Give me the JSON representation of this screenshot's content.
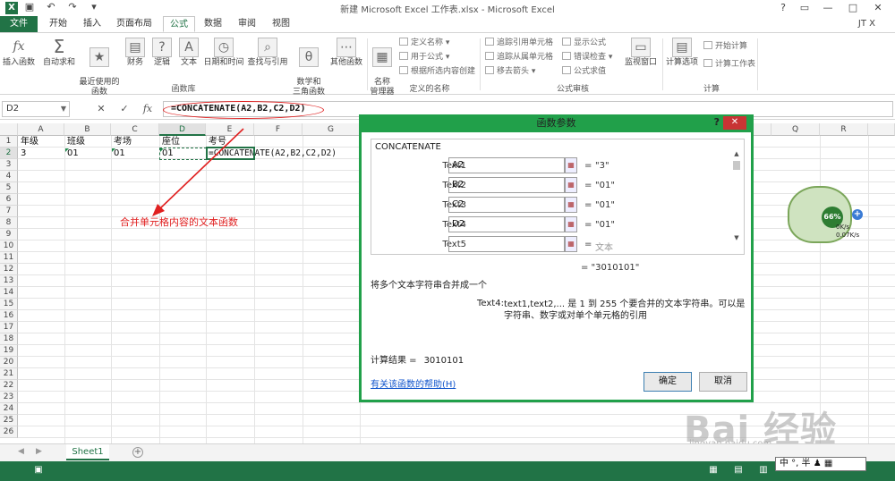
{
  "app": {
    "logo": "X",
    "title": "新建 Microsoft Excel 工作表.xlsx - Microsoft Excel",
    "user": "JT X",
    "qat": [
      "save-icon",
      "undo-icon",
      "redo-icon",
      "customize-icon"
    ],
    "window_controls": [
      "?",
      "▭",
      "—",
      "□",
      "✕"
    ]
  },
  "tabs": [
    "文件",
    "开始",
    "插入",
    "页面布局",
    "公式",
    "数据",
    "审阅",
    "视图"
  ],
  "active_tab": "公式",
  "ribbon": {
    "groups": [
      {
        "label": "函数库",
        "buttons": [
          {
            "label": "插入函数",
            "icon": "fx"
          },
          {
            "label": "自动求和",
            "icon": "Σ"
          },
          {
            "label": "最近使用的\n函数",
            "icon": "★"
          },
          {
            "label": "财务",
            "icon": "▤"
          },
          {
            "label": "逻辑",
            "icon": "?"
          },
          {
            "label": "文本",
            "icon": "A"
          },
          {
            "label": "日期和时间",
            "icon": "◷"
          },
          {
            "label": "查找与引用",
            "icon": "⌕"
          },
          {
            "label": "数学和\n三角函数",
            "icon": "θ"
          },
          {
            "label": "其他函数",
            "icon": "⋯"
          }
        ]
      },
      {
        "label": "定义的名称",
        "buttons": [
          {
            "label": "名称\n管理器",
            "icon": "▦"
          }
        ],
        "small": [
          "定义名称 ▾",
          "用于公式 ▾",
          "根据所选内容创建"
        ]
      },
      {
        "label": "公式审核",
        "small": [
          "追踪引用单元格",
          "追踪从属单元格",
          "移去箭头 ▾",
          "显示公式",
          "错误检查 ▾",
          "公式求值"
        ],
        "buttons": [
          {
            "label": "监视窗口",
            "icon": "▭"
          }
        ]
      },
      {
        "label": "计算",
        "buttons": [
          {
            "label": "计算选项",
            "icon": "▤"
          }
        ],
        "small": [
          "开始计算",
          "计算工作表"
        ]
      }
    ]
  },
  "formula_bar": {
    "name_box": "D2",
    "cancel": "✕",
    "enter": "✓",
    "fx": "fx",
    "formula": "=CONCATENATE(A2,B2,C2,D2)"
  },
  "sheet": {
    "columns": [
      "A",
      "B",
      "C",
      "D",
      "E",
      "F",
      "G",
      "Q",
      "R"
    ],
    "rows": [
      "1",
      "2",
      "3",
      "4",
      "5",
      "6",
      "7",
      "8",
      "9",
      "10",
      "11",
      "12",
      "13",
      "14",
      "15",
      "16",
      "17",
      "18",
      "19",
      "20",
      "21",
      "22",
      "23",
      "24",
      "25",
      "26"
    ],
    "row1": [
      "年级",
      "班级",
      "考场",
      "座位",
      "考号"
    ],
    "row2": [
      "3",
      "01",
      "01",
      "01",
      "=CONCATENATE(A2,B2,C2,D2)"
    ]
  },
  "annotation": "合并单元格内容的文本函数",
  "dialog": {
    "title": "函数参数",
    "help_button": "?",
    "close_button": "✕",
    "function_name": "CONCATENATE",
    "args": [
      {
        "label": "Text1",
        "value": "A2",
        "result": "\"3\""
      },
      {
        "label": "Text2",
        "value": "B2",
        "result": "\"01\""
      },
      {
        "label": "Text3",
        "value": "C2",
        "result": "\"01\""
      },
      {
        "label": "Text4",
        "value": "D2",
        "result": "\"01\""
      },
      {
        "label": "Text5",
        "value": "",
        "result": "文本"
      }
    ],
    "equals": "=",
    "formula_result": "= \"3010101\"",
    "description": "将多个文本字符串合并成一个",
    "arg_help_label": "Text4:",
    "arg_help_text": "text1,text2,... 是 1 到 255 个要合并的文本字符串。可以是字符串、数字或对单个单元格的引用",
    "calc_result_label": "计算结果 =",
    "calc_result_value": "3010101",
    "help_link": "有关该函数的帮助(H)",
    "ok": "确定",
    "cancel": "取消"
  },
  "sheet_tabs": {
    "active": "Sheet1",
    "add": "+"
  },
  "ime": "中 °, 半 ♟ ▦",
  "widget": {
    "percent": "66%",
    "up_speed": "0K/s",
    "down_speed": "0.07K/s",
    "plus": "+"
  },
  "watermark": "Bai 经验",
  "watermark_sub": "jingyan.baidu.com",
  "colors": {
    "excel_green": "#217346",
    "dialog_border": "#21a04a",
    "annotation_red": "#e02020"
  }
}
